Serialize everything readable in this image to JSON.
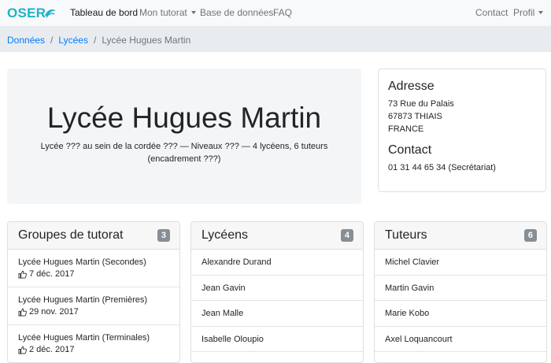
{
  "navbar": {
    "brand": "OSER",
    "links": {
      "dashboard": "Tableau de bord",
      "tutoring": "Mon tutorat",
      "database": "Base de données",
      "faq": "FAQ",
      "contact": "Contact",
      "profile": "Profil"
    }
  },
  "breadcrumb": {
    "items": [
      "Données",
      "Lycées",
      "Lycée Hugues Martin"
    ],
    "separator": "/"
  },
  "school": {
    "name": "Lycée Hugues Martin",
    "lead_line1": "Lycée ??? au sein de la cordée ??? — Niveaux ??? — 4 lycéens, 6 tuteurs",
    "lead_line2": "(encadrement ???)"
  },
  "address_card": {
    "address_heading": "Adresse",
    "address_lines": [
      "73 Rue du Palais",
      "67873 THIAIS",
      "FRANCE"
    ],
    "contact_heading": "Contact",
    "phone": "01 31 44 65 34 (Secrétariat)"
  },
  "groups": {
    "title": "Groupes de tutorat",
    "count": "3",
    "items": [
      {
        "name": "Lycée Hugues Martin (Secondes)",
        "date": "7 déc. 2017"
      },
      {
        "name": "Lycée Hugues Martin (Premières)",
        "date": "29 nov. 2017"
      },
      {
        "name": "Lycée Hugues Martin (Terminales)",
        "date": "2 déc. 2017"
      }
    ]
  },
  "students": {
    "title": "Lycéens",
    "count": "4",
    "items": [
      "Alexandre Durand",
      "Jean Gavin",
      "Jean Malle",
      "Isabelle Oloupio"
    ]
  },
  "tutors": {
    "title": "Tuteurs",
    "count": "6",
    "items": [
      "Michel Clavier",
      "Martin Gavin",
      "Marie Kobo",
      "Axel Loquancourt"
    ]
  },
  "colors": {
    "brand": "#1cb3c8",
    "link": "#007bff",
    "badge": "#868e96"
  },
  "icons": {
    "date_icon": "thumbs-up-icon"
  }
}
